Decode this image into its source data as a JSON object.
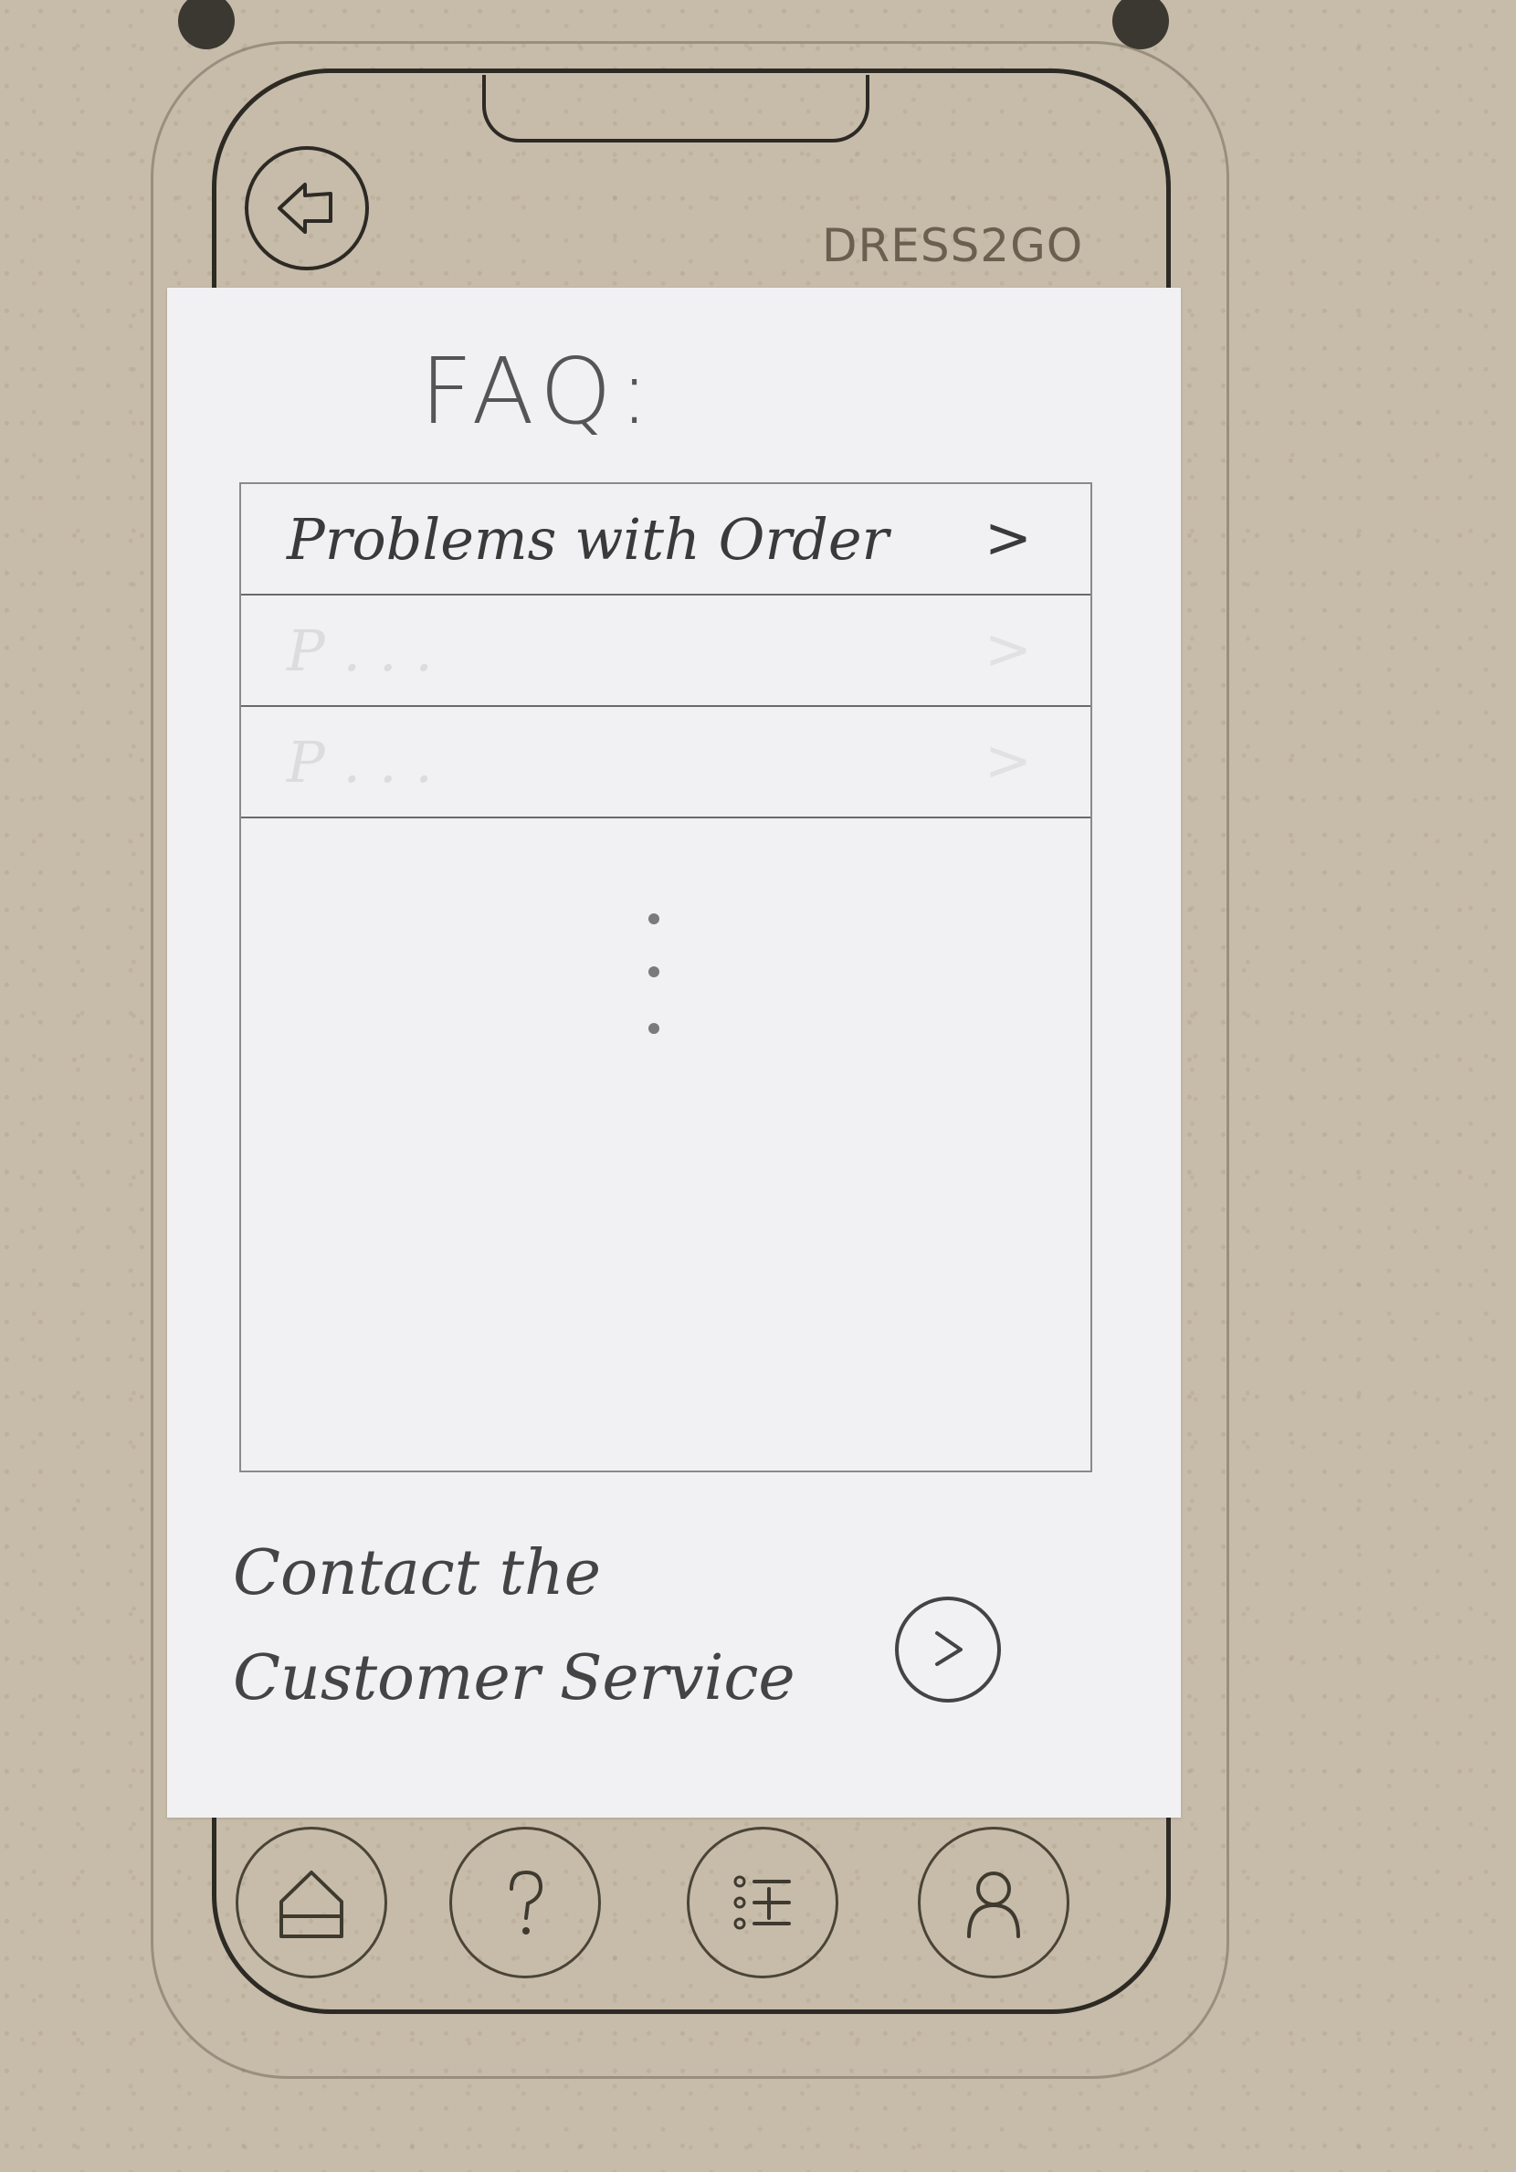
{
  "header": {
    "back_icon": "back-arrow-icon",
    "brand": "DRESS2GO"
  },
  "faq": {
    "title": "FAQ:",
    "items": [
      {
        "label": "Problems with Order",
        "chevron": ">",
        "faded": false
      },
      {
        "label": "P . . .",
        "chevron": ">",
        "faded": true
      },
      {
        "label": "P . . .",
        "chevron": ">",
        "faded": true
      }
    ],
    "more_icon": "vertical-ellipsis-icon"
  },
  "contact": {
    "line1": "Contact the",
    "line2": "Customer Service",
    "button_icon": "chevron-right-circle-icon"
  },
  "bottom_nav": {
    "items": [
      {
        "icon": "home-icon"
      },
      {
        "icon": "help-icon"
      },
      {
        "icon": "list-icon"
      },
      {
        "icon": "user-icon"
      }
    ]
  },
  "colors": {
    "cardboard": "#c7bca9",
    "paper": "#f1f1f3",
    "pencil": "#3a3a3a"
  }
}
